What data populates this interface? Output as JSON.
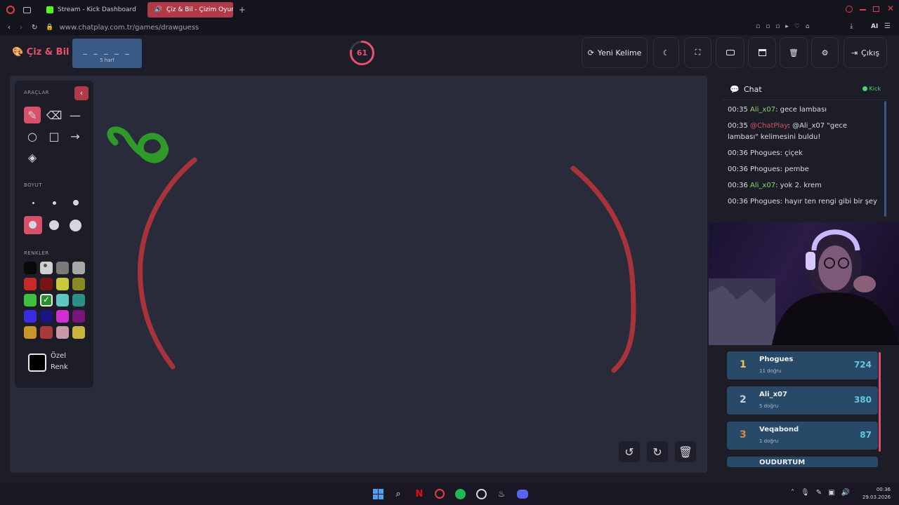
{
  "browser": {
    "tabs": [
      {
        "label": "Stream - Kick Dashboard"
      },
      {
        "label": "Çiz & Bil - Çizim Oyunu"
      }
    ],
    "url": "www.chatplay.com.tr/games/drawguess",
    "ai_label": "AI"
  },
  "header": {
    "logo": "Çiz & Bil",
    "word_mask": "_ _ _ _ _",
    "word_hint": "5 harf",
    "timer": "61",
    "timer_fraction": 0.78,
    "buttons": {
      "new_word": "Yeni Kelime",
      "exit": "Çıkış"
    }
  },
  "tools": {
    "title": "ARAÇLAR",
    "size_title": "BOYUT",
    "colors_title": "RENKLER",
    "custom_color_line1": "Özel",
    "custom_color_line2": "Renk",
    "custom_color_value": "#000000",
    "palette": [
      "#0a0a0a",
      "#d0d0d0",
      "#7a7a7a",
      "#a8a8a8",
      "#c82a2a",
      "#7a1313",
      "#c8c840",
      "#8a8a22",
      "#3fbf3f",
      "#2a8f2a",
      "#5fc7c0",
      "#2b8f86",
      "#3a2ae0",
      "#1a1580",
      "#d030d0",
      "#7a147a",
      "#c8962a",
      "#a83a3a",
      "#c89aa8",
      "#c8b43a"
    ],
    "selected_color_index": 9
  },
  "chat": {
    "title": "Chat",
    "status": "Kick",
    "messages": [
      {
        "time": "00:35",
        "user": "Ali_x07",
        "text": ": gece lambası",
        "color": "#8fd46b"
      },
      {
        "time": "00:35",
        "user": "@ChatPlay",
        "text": ": @Ali_x07 \"gece lambası\" kelimesini buldu!",
        "color": "#d9506a"
      },
      {
        "time": "00:36",
        "user": "Phogues",
        "text": ": çiçek",
        "color": "#dcdde5"
      },
      {
        "time": "00:36",
        "user": "Phogues",
        "text": ": pembe",
        "color": "#dcdde5"
      },
      {
        "time": "00:36",
        "user": "Ali_x07",
        "text": ": yok 2. krem",
        "color": "#8fd46b"
      },
      {
        "time": "00:36",
        "user": "Phogues",
        "text": ": hayır ten rengi gibi bir şey",
        "color": "#dcdde5"
      }
    ]
  },
  "leaderboard": [
    {
      "rank": "1",
      "name": "Phogues",
      "sub": "11 doğru",
      "score": "724",
      "rank_color": "#e8c24a"
    },
    {
      "rank": "2",
      "name": "Ali_x07",
      "sub": "5 doğru",
      "score": "380",
      "rank_color": "#c7ccd6"
    },
    {
      "rank": "3",
      "name": "Veqabond",
      "sub": "1 doğru",
      "score": "87",
      "rank_color": "#d58a4a"
    },
    {
      "rank": "",
      "name": "OUDURTUM",
      "sub": "",
      "score": "",
      "rank_color": "#e8c24a"
    }
  ],
  "taskbar": {
    "time": "00:36",
    "date": "29.03.2026"
  }
}
